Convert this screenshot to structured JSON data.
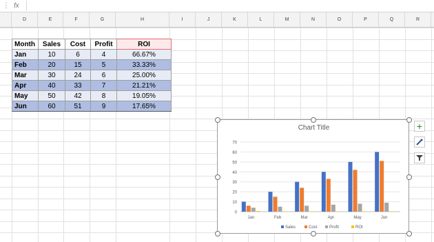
{
  "formula_bar": {
    "name_box": "",
    "fx_label": "fx",
    "value": ""
  },
  "columns": [
    "D",
    "E",
    "F",
    "G",
    "H",
    "I",
    "J",
    "K",
    "L",
    "M",
    "N",
    "O",
    "P",
    "Q",
    "R"
  ],
  "table": {
    "headers": [
      "Month",
      "Sales",
      "Cost",
      "Profit",
      "ROI"
    ],
    "rows": [
      {
        "month": "Jan",
        "sales": "10",
        "cost": "6",
        "profit": "4",
        "roi": "66.67%"
      },
      {
        "month": "Feb",
        "sales": "20",
        "cost": "15",
        "profit": "5",
        "roi": "33.33%"
      },
      {
        "month": "Mar",
        "sales": "30",
        "cost": "24",
        "profit": "6",
        "roi": "25.00%"
      },
      {
        "month": "Apr",
        "sales": "40",
        "cost": "33",
        "profit": "7",
        "roi": "21.21%"
      },
      {
        "month": "May",
        "sales": "50",
        "cost": "42",
        "profit": "8",
        "roi": "19.05%"
      },
      {
        "month": "Jun",
        "sales": "60",
        "cost": "51",
        "profit": "9",
        "roi": "17.65%"
      }
    ]
  },
  "chart_data": {
    "type": "bar",
    "title": "Chart Title",
    "categories": [
      "Jan",
      "Feb",
      "Mar",
      "Apr",
      "May",
      "Jun"
    ],
    "series": [
      {
        "name": "Sales",
        "color": "#4472c4",
        "values": [
          10,
          20,
          30,
          40,
          50,
          60
        ]
      },
      {
        "name": "Cost",
        "color": "#ed7d31",
        "values": [
          6,
          15,
          24,
          33,
          42,
          51
        ]
      },
      {
        "name": "Profit",
        "color": "#a5a5a5",
        "values": [
          4,
          5,
          6,
          7,
          8,
          9
        ]
      },
      {
        "name": "ROI",
        "color": "#ffc000",
        "values": [
          0.6667,
          0.3333,
          0.25,
          0.2121,
          0.1905,
          0.1765
        ]
      }
    ],
    "ylim": [
      0,
      70
    ],
    "yticks": [
      "0",
      "10",
      "20",
      "30",
      "40",
      "50",
      "60",
      "70"
    ],
    "grid": true,
    "legend": "bottom"
  },
  "tools": {
    "add_icon": "plus-icon",
    "style_icon": "brush-icon",
    "filter_icon": "filter-icon"
  }
}
